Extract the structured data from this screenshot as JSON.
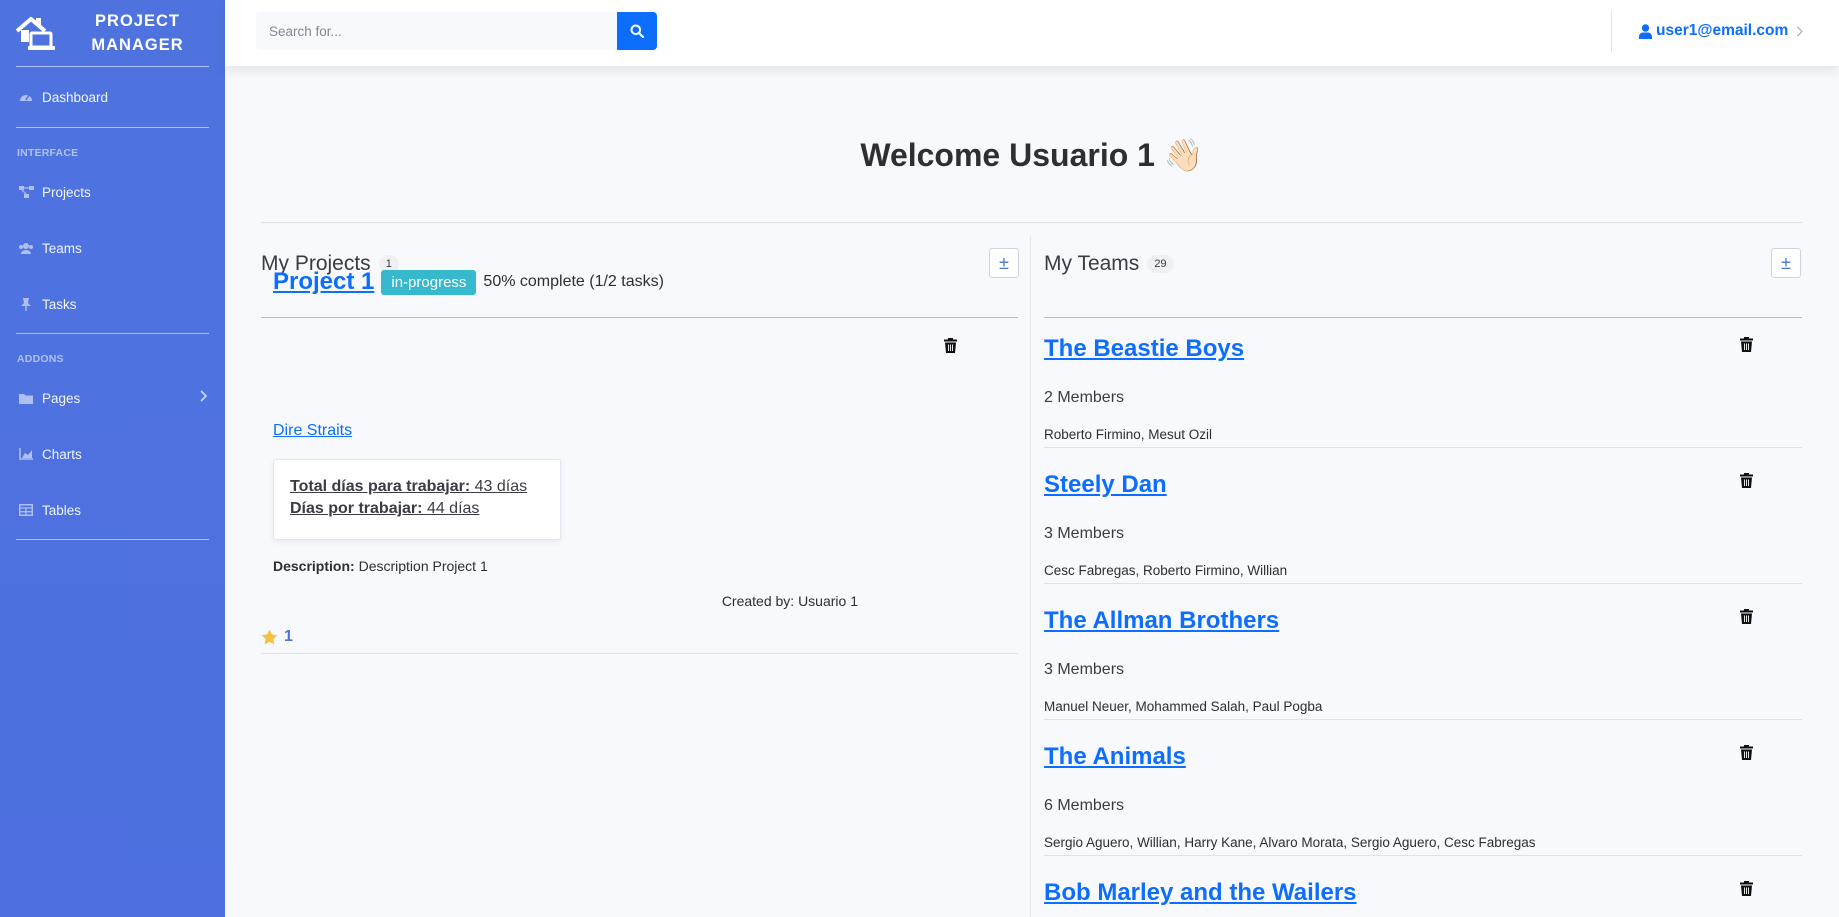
{
  "brand": {
    "title_line1": "PROJECT",
    "title_line2": "MANAGER",
    "icon": "house-laptop-icon"
  },
  "sidebar": {
    "items": [
      {
        "label": "Dashboard",
        "icon": "tachometer-icon"
      }
    ],
    "sections": [
      {
        "heading": "INTERFACE",
        "items": [
          {
            "label": "Projects",
            "icon": "project-diagram-icon"
          },
          {
            "label": "Teams",
            "icon": "users-icon"
          },
          {
            "label": "Tasks",
            "icon": "thumbtack-icon"
          }
        ]
      },
      {
        "heading": "ADDONS",
        "items": [
          {
            "label": "Pages",
            "icon": "folder-icon"
          },
          {
            "label": "Charts",
            "icon": "chart-area-icon"
          },
          {
            "label": "Tables",
            "icon": "table-icon"
          }
        ]
      }
    ]
  },
  "topbar": {
    "search": {
      "placeholder": "Search for...",
      "value": ""
    },
    "user_email": "user1@email.com"
  },
  "main": {
    "welcome": "Welcome Usuario 1 👋🏻",
    "projects": {
      "title": "My Projects",
      "count": "1",
      "add_label": "±",
      "items": [
        {
          "name": "Project 1",
          "status": "in-progress",
          "progress_text": "50% complete (1/2 tasks)",
          "team": "Dire Straits",
          "total_days_label": "Total días para trabajar:",
          "total_days_value": "43 días",
          "remaining_days_label": "Días por trabajar:",
          "remaining_days_value": "44 días",
          "description_label": "Description:",
          "description": "Description Project 1",
          "created_by": "Created by: Usuario 1",
          "stars": "1"
        }
      ]
    },
    "teams": {
      "title": "My Teams",
      "count": "29",
      "add_label": "±",
      "items": [
        {
          "name": "The Beastie Boys",
          "members_count": "2 Members",
          "members": "Roberto Firmino, Mesut Ozil"
        },
        {
          "name": "Steely Dan",
          "members_count": "3 Members",
          "members": "Cesc Fabregas, Roberto Firmino, Willian"
        },
        {
          "name": "The Allman Brothers",
          "members_count": "3 Members",
          "members": "Manuel Neuer, Mohammed Salah, Paul Pogba"
        },
        {
          "name": "The Animals",
          "members_count": "6 Members",
          "members": "Sergio Aguero, Willian, Harry Kane, Alvaro Morata, Sergio Aguero, Cesc Fabregas"
        },
        {
          "name": "Bob Marley and the Wailers",
          "members_count": "",
          "members": ""
        }
      ]
    }
  },
  "colors": {
    "sidebar": "#4e73df",
    "primary": "#0d6efd",
    "badge_info": "#36b9cc",
    "star": "#f6c23e"
  }
}
